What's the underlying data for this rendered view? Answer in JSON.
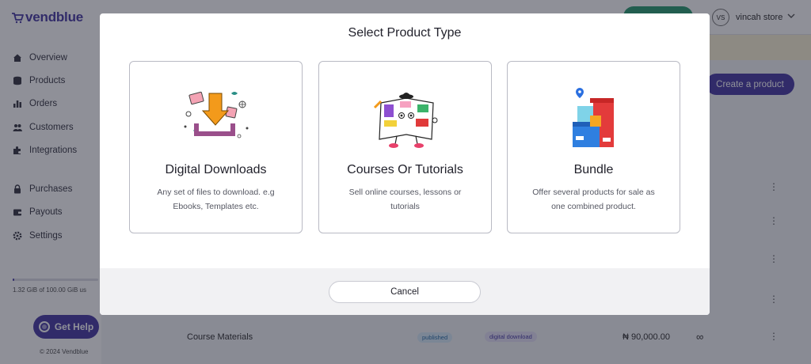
{
  "brand": {
    "name": "vendblue",
    "color": "#4b3fa6"
  },
  "sidebar": {
    "items": [
      {
        "label": "Overview",
        "icon": "home-icon"
      },
      {
        "label": "Products",
        "icon": "database-icon"
      },
      {
        "label": "Orders",
        "icon": "bar-chart-icon"
      },
      {
        "label": "Customers",
        "icon": "users-icon"
      },
      {
        "label": "Integrations",
        "icon": "puzzle-icon"
      }
    ],
    "items2": [
      {
        "label": "Purchases",
        "icon": "lock-icon"
      },
      {
        "label": "Payouts",
        "icon": "wallet-icon"
      },
      {
        "label": "Settings",
        "icon": "gear-icon"
      }
    ],
    "storage": {
      "text": "1.32 GiB of 100.00 GiB us",
      "fraction": 0.0132
    },
    "help_label": "Get Help",
    "copyright": "© 2024 Vendblue"
  },
  "topbar": {
    "avatar_initials": "VS",
    "store_name": "vincah store"
  },
  "main": {
    "create_label": "Create a product",
    "row": {
      "title": "Course Materials",
      "status": "published",
      "type": "digital download",
      "price": "₦ 90,000.00",
      "stock": "∞"
    }
  },
  "modal": {
    "title": "Select Product Type",
    "cards": [
      {
        "title": "Digital Downloads",
        "desc": "Any set of files to download. e.g Ebooks, Templates etc."
      },
      {
        "title": "Courses Or Tutorials",
        "desc": "Sell online courses, lessons or tutorials"
      },
      {
        "title": "Bundle",
        "desc": "Offer several products for sale as one combined product."
      }
    ],
    "cancel_label": "Cancel"
  }
}
